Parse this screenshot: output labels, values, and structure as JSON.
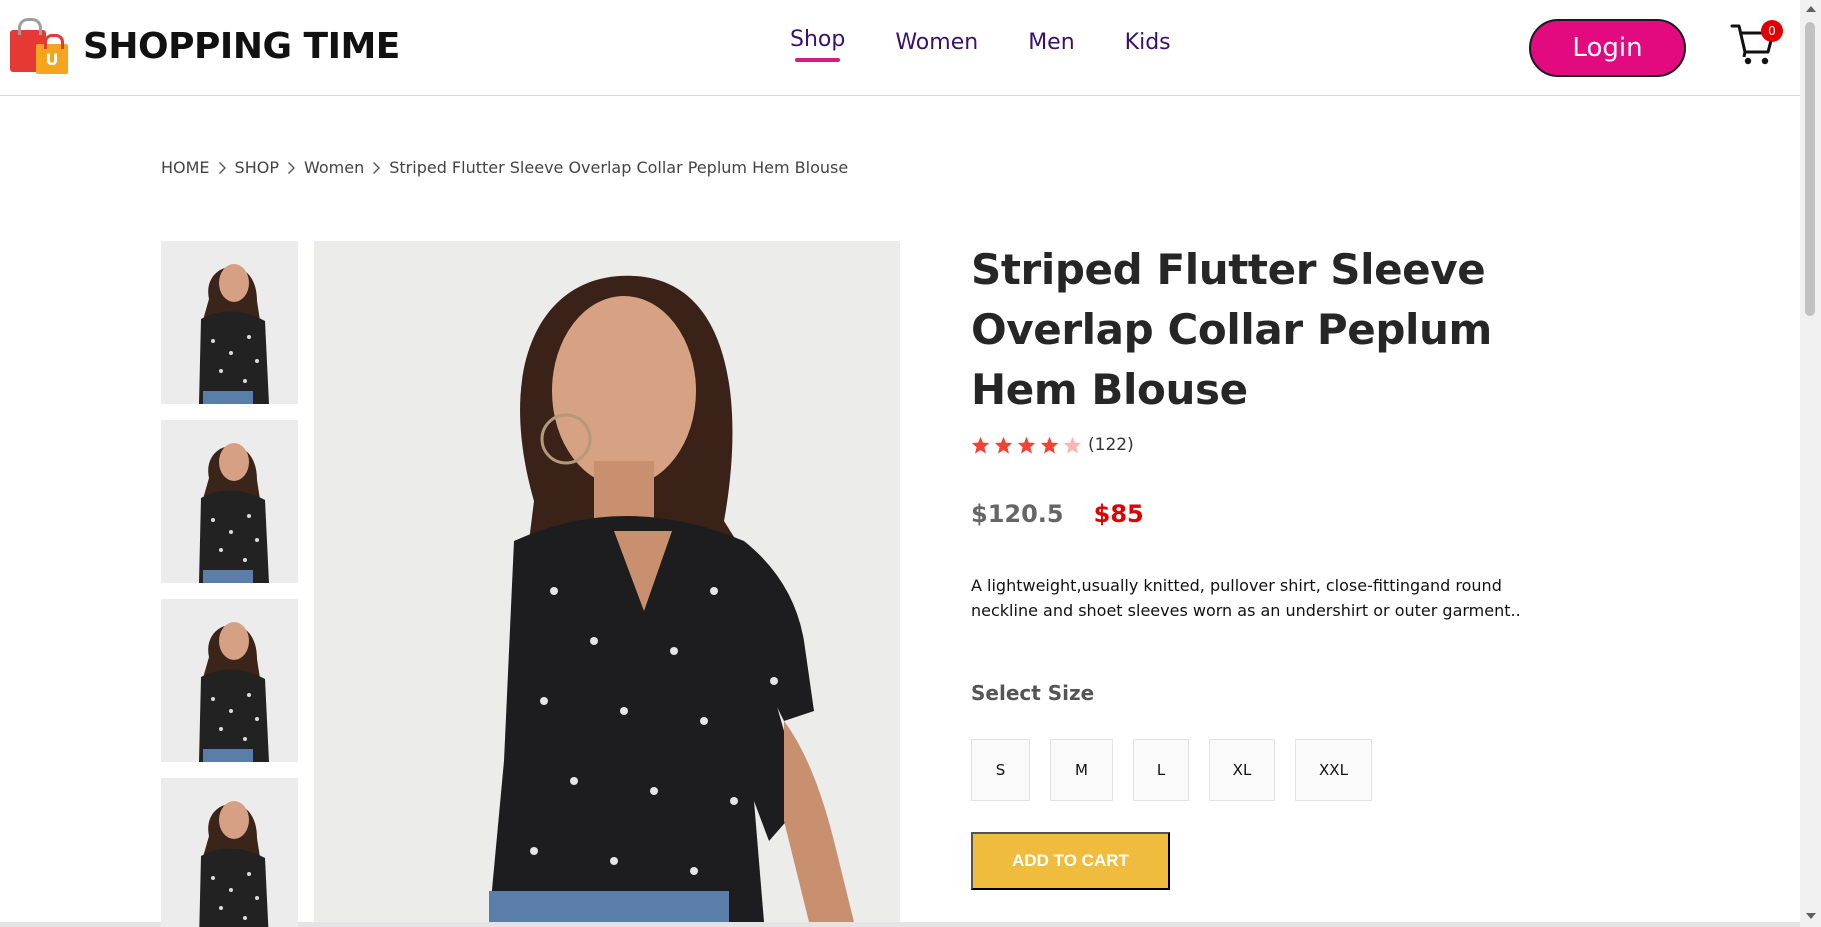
{
  "brand": {
    "name": "SHOPPING TIME",
    "logo_letter": "U"
  },
  "nav": {
    "shop": "Shop",
    "women": "Women",
    "men": "Men",
    "kids": "Kids"
  },
  "header": {
    "login_label": "Login",
    "cart_count": "0"
  },
  "breadcrumb": [
    "HOME",
    "SHOP",
    "Women",
    "Striped Flutter Sleeve Overlap Collar Peplum Hem Blouse"
  ],
  "product": {
    "title": "Striped Flutter Sleeve Overlap Collar Peplum Hem Blouse",
    "rating": 4.5,
    "reviews": "(122)",
    "old_price": "$120.5",
    "price": "$85",
    "description": "A lightweight,usually knitted, pullover shirt, close-fittingand round neckline and shoet sleeves worn as an undershirt or outer garment..",
    "size_label": "Select Size",
    "sizes": [
      "S",
      "M",
      "L",
      "XL",
      "XXL"
    ],
    "add_to_cart": "ADD TO CART"
  },
  "colors": {
    "accent": "#e3097e",
    "nav_text": "#3a0f74",
    "price_red": "#e00000",
    "star": "#f44336",
    "cart_button": "#f0bc3e"
  },
  "icons": {
    "logo": "shopping-bag-icon",
    "cart": "cart-icon",
    "breadcrumb_separator": "chevron-right-icon",
    "rating": "star-icon"
  }
}
